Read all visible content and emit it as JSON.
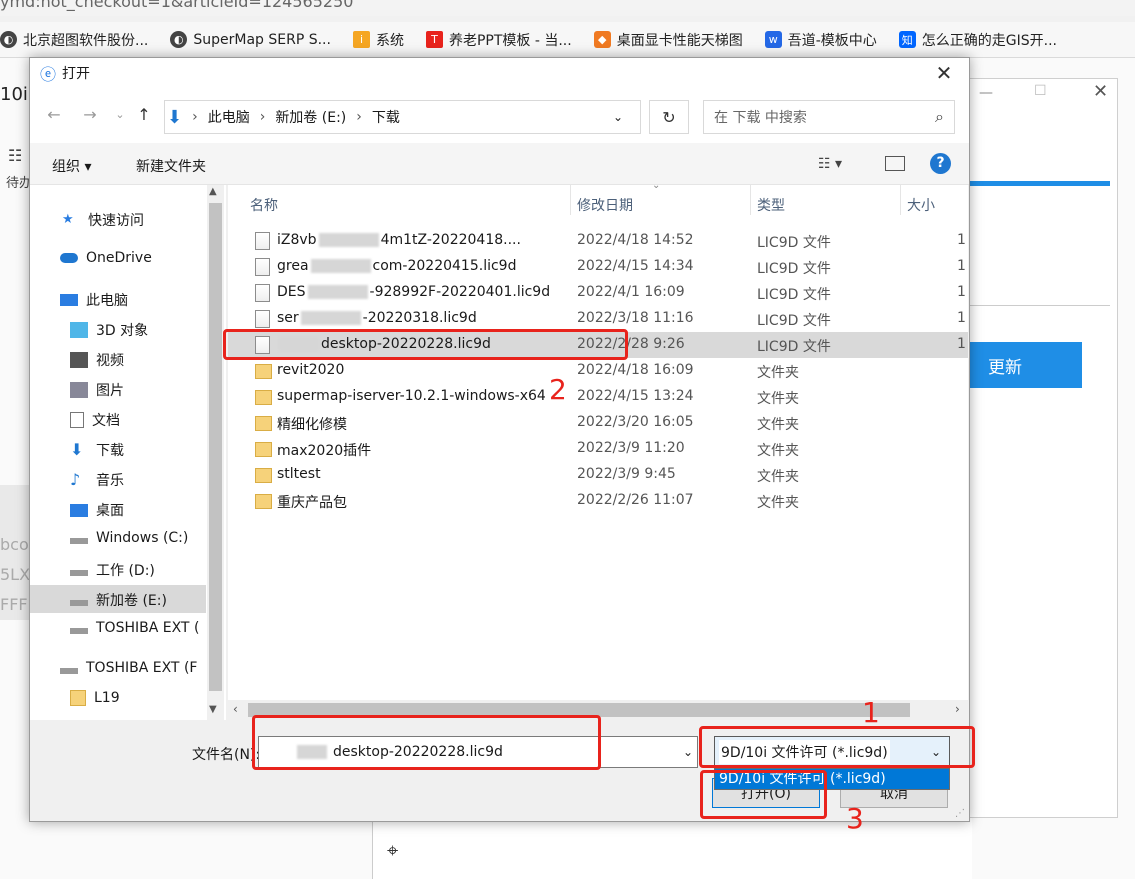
{
  "browser": {
    "url_fragment": "ymd:not_checkout=1&articleId=124565250",
    "bookmarks": [
      {
        "label": "北京超图软件股份...",
        "icon": "globe-icon"
      },
      {
        "label": "SuperMap SERP S...",
        "icon": "globe-icon"
      },
      {
        "label": "系统",
        "icon": "system-icon"
      },
      {
        "label": "养老PPT模板 - 当...",
        "icon": "td-icon"
      },
      {
        "label": "桌面显卡性能天梯图",
        "icon": "fox-icon"
      },
      {
        "label": "吾道-模板中心",
        "icon": "wudao-icon"
      },
      {
        "label": "怎么正确的走GIS开...",
        "icon": "zhihu-icon"
      }
    ]
  },
  "background_app": {
    "title_fragment": "10i)",
    "left_label": "待办",
    "update_button": "更新",
    "left_lines": [
      "bco",
      "5LX",
      "FFF"
    ]
  },
  "dialog": {
    "title": "打开",
    "breadcrumb": [
      "此电脑",
      "新加卷 (E:)",
      "下载"
    ],
    "search_placeholder": "在 下载 中搜索",
    "toolbar": {
      "organize": "组织 ▾",
      "new_folder": "新建文件夹"
    },
    "nav_items": [
      {
        "label": "快速访问",
        "icon": "star-icon"
      },
      {
        "label": "OneDrive",
        "icon": "cloud-icon"
      },
      {
        "label": "此电脑",
        "icon": "computer-icon"
      },
      {
        "label": "3D 对象",
        "icon": "cube-icon"
      },
      {
        "label": "视频",
        "icon": "video-icon"
      },
      {
        "label": "图片",
        "icon": "picture-icon"
      },
      {
        "label": "文档",
        "icon": "document-icon"
      },
      {
        "label": "下载",
        "icon": "download-icon"
      },
      {
        "label": "音乐",
        "icon": "music-icon"
      },
      {
        "label": "桌面",
        "icon": "desktop-icon"
      },
      {
        "label": "Windows (C:)",
        "icon": "drive-icon"
      },
      {
        "label": "工作 (D:)",
        "icon": "drive-icon"
      },
      {
        "label": "新加卷 (E:)",
        "icon": "drive-icon"
      },
      {
        "label": "TOSHIBA EXT (",
        "icon": "drive-icon"
      },
      {
        "label": "TOSHIBA EXT (F",
        "icon": "drive-icon"
      },
      {
        "label": "L19",
        "icon": "folder-icon"
      }
    ],
    "columns": {
      "name": "名称",
      "date": "修改日期",
      "type": "类型",
      "size": "大小"
    },
    "files": [
      {
        "name_a": "iZ8vb",
        "name_b": "4m1tZ-20220418....",
        "date": "2022/4/18 14:52",
        "type": "LIC9D 文件",
        "size": "1",
        "kind": "file"
      },
      {
        "name_a": "grea",
        "name_b": "com-20220415.lic9d",
        "date": "2022/4/15 14:34",
        "type": "LIC9D 文件",
        "size": "1",
        "kind": "file"
      },
      {
        "name_a": "DES",
        "name_b": "-928992F-20220401.lic9d",
        "date": "2022/4/1 16:09",
        "type": "LIC9D 文件",
        "size": "1",
        "kind": "file"
      },
      {
        "name_a": "ser",
        "name_b": "-20220318.lic9d",
        "date": "2022/3/18 11:16",
        "type": "LIC9D 文件",
        "size": "1",
        "kind": "file"
      },
      {
        "name_a": "",
        "name_b": "desktop-20220228.lic9d",
        "date": "2022/2/28 9:26",
        "type": "LIC9D 文件",
        "size": "1",
        "kind": "file",
        "selected": true
      },
      {
        "name_a": "revit2020",
        "name_b": "",
        "date": "2022/4/18 16:09",
        "type": "文件夹",
        "size": "",
        "kind": "folder"
      },
      {
        "name_a": "supermap-iserver-10.2.1-windows-x64",
        "name_b": "",
        "date": "2022/4/15 13:24",
        "type": "文件夹",
        "size": "",
        "kind": "folder"
      },
      {
        "name_a": "精细化修模",
        "name_b": "",
        "date": "2022/3/20 16:05",
        "type": "文件夹",
        "size": "",
        "kind": "folder"
      },
      {
        "name_a": "max2020插件",
        "name_b": "",
        "date": "2022/3/9 11:20",
        "type": "文件夹",
        "size": "",
        "kind": "folder"
      },
      {
        "name_a": "stltest",
        "name_b": "",
        "date": "2022/3/9 9:45",
        "type": "文件夹",
        "size": "",
        "kind": "folder"
      },
      {
        "name_a": "重庆产品包",
        "name_b": "",
        "date": "2022/2/26 11:07",
        "type": "文件夹",
        "size": "",
        "kind": "folder"
      }
    ],
    "filename_label": "文件名(N):",
    "filename_value": "desktop-20220228.lic9d",
    "filetype_value": "9D/10i 文件许可 (*.lic9d)",
    "filetype_option": "9D/10i 文件许可 (*.lic9d)",
    "open_button": "打开(O)",
    "cancel_button": "取消"
  },
  "annotations": {
    "labels": [
      "1",
      "2",
      "3"
    ],
    "color": "#e8231c"
  }
}
